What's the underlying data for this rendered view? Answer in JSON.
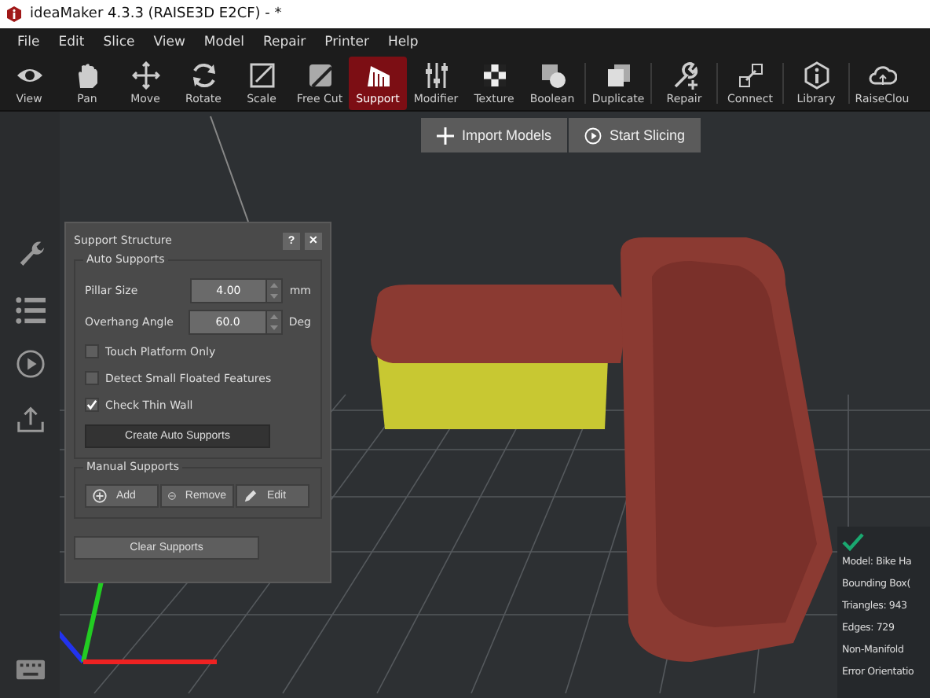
{
  "window": {
    "title": "ideaMaker 4.3.3 (RAISE3D E2CF) - *"
  },
  "menu": [
    "File",
    "Edit",
    "Slice",
    "View",
    "Model",
    "Repair",
    "Printer",
    "Help"
  ],
  "toolbar": [
    {
      "label": "View",
      "selected": false
    },
    {
      "label": "Pan",
      "selected": false
    },
    {
      "label": "Move",
      "selected": false
    },
    {
      "label": "Rotate",
      "selected": false
    },
    {
      "label": "Scale",
      "selected": false
    },
    {
      "label": "Free Cut",
      "selected": false
    },
    {
      "label": "Support",
      "selected": true
    },
    {
      "label": "Modifier",
      "selected": false
    },
    {
      "label": "Texture",
      "selected": false
    },
    {
      "label": "Boolean",
      "selected": false
    },
    {
      "label": "Duplicate",
      "selected": false
    },
    {
      "label": "Repair",
      "selected": false
    },
    {
      "label": "Connect",
      "selected": false
    },
    {
      "label": "Library",
      "selected": false
    },
    {
      "label": "RaiseClou",
      "selected": false
    }
  ],
  "actions": [
    "Import Models",
    "Start Slicing"
  ],
  "support_panel": {
    "title": "Support Structure",
    "help": "?",
    "close": "✕",
    "auto": {
      "title": "Auto Supports",
      "fields": [
        {
          "label": "Pillar Size",
          "value": "4.00",
          "unit": "mm"
        },
        {
          "label": "Overhang Angle",
          "value": "60.0",
          "unit": "Deg"
        }
      ],
      "options": [
        {
          "label": "Touch Platform Only",
          "checked": false
        },
        {
          "label": "Detect Small Floated Features",
          "checked": false
        },
        {
          "label": "Check Thin Wall",
          "checked": true
        }
      ],
      "button": "Create Auto Supports"
    },
    "manual": {
      "title": "Manual Supports",
      "buttons": [
        "Add",
        "Remove",
        "Edit"
      ]
    },
    "clear": "Clear Supports"
  },
  "model_info": [
    "Model: Bike Ha",
    "Bounding Box(",
    "Triangles: 943",
    "Edges: 729",
    "Non-Manifold",
    "Error Orientatio"
  ]
}
